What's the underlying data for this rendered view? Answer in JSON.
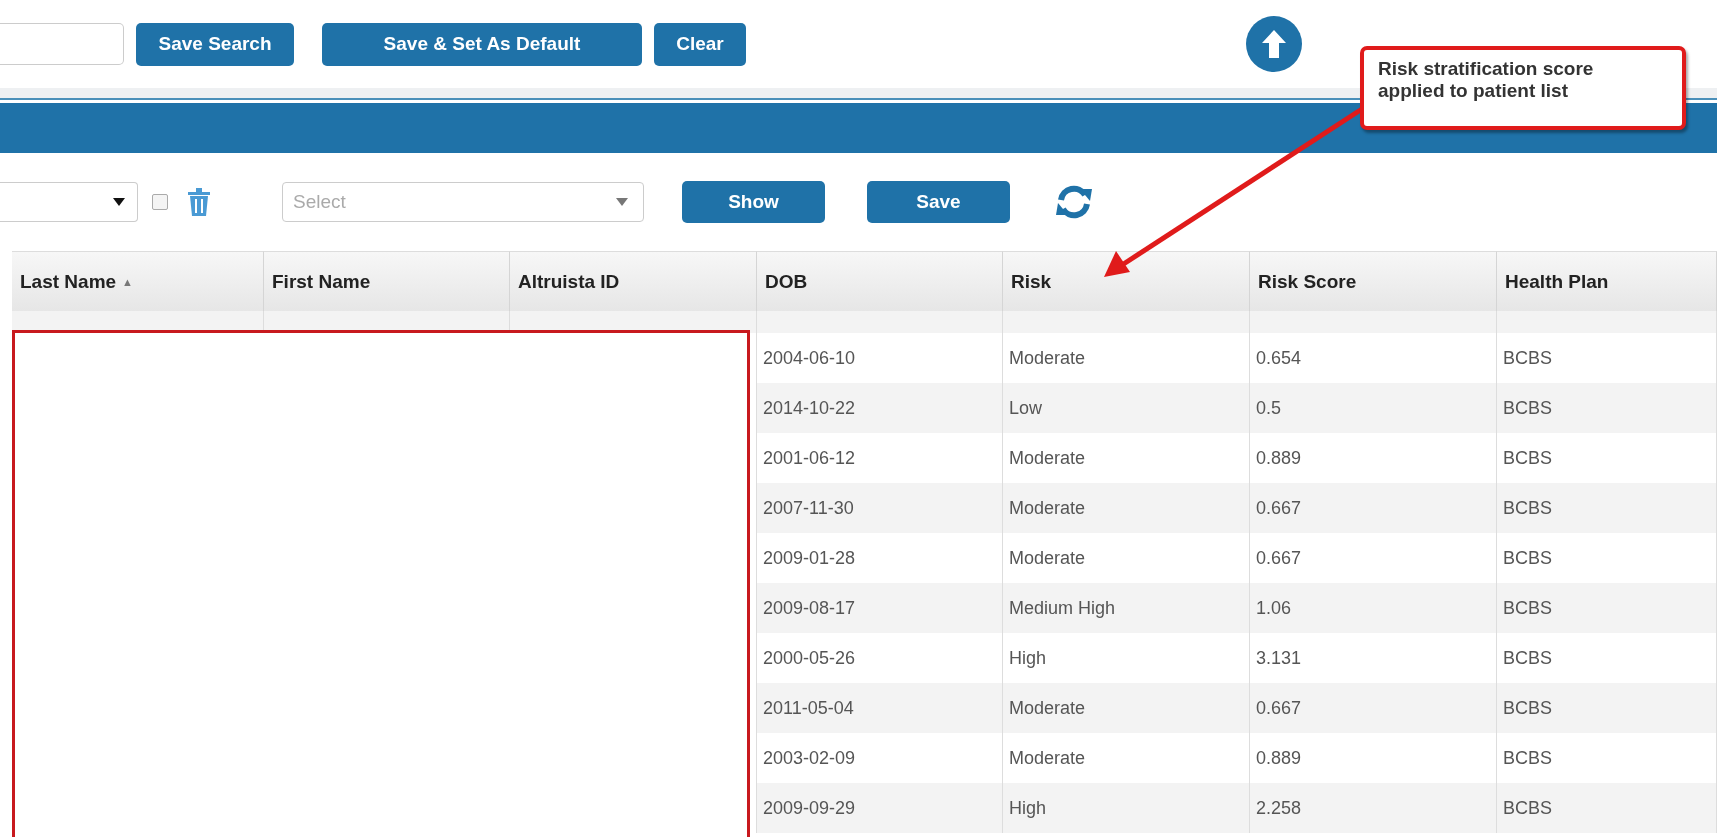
{
  "toolbar": {
    "buttons": [
      "Save Search",
      "Save & Set As Default",
      "Clear"
    ]
  },
  "filters": {
    "select": {
      "placeholder": "Select"
    },
    "checkbox": {
      "checked": false
    },
    "buttons": [
      "Show",
      "Save"
    ]
  },
  "table": {
    "columns": [
      {
        "label": "Last Name",
        "sort": "▲"
      },
      {
        "label": "First Name"
      },
      {
        "label": "Altruista ID"
      },
      {
        "label": "DOB"
      },
      {
        "label": "Risk"
      },
      {
        "label": "Risk Score"
      },
      {
        "label": "Health Plan"
      }
    ],
    "rows": [
      {
        "dob": "2004-06-10",
        "risk": "Moderate",
        "risk_score": "0.654",
        "health_plan": "BCBS"
      },
      {
        "dob": "2014-10-22",
        "risk": "Low",
        "risk_score": "0.5",
        "health_plan": "BCBS"
      },
      {
        "dob": "2001-06-12",
        "risk": "Moderate",
        "risk_score": "0.889",
        "health_plan": "BCBS"
      },
      {
        "dob": "2007-11-30",
        "risk": "Moderate",
        "risk_score": "0.667",
        "health_plan": "BCBS"
      },
      {
        "dob": "2009-01-28",
        "risk": "Moderate",
        "risk_score": "0.667",
        "health_plan": "BCBS"
      },
      {
        "dob": "2009-08-17",
        "risk": "Medium High",
        "risk_score": "1.06",
        "health_plan": "BCBS"
      },
      {
        "dob": "2000-05-26",
        "risk": "High",
        "risk_score": "3.131",
        "health_plan": "BCBS"
      },
      {
        "dob": "2011-05-04",
        "risk": "Moderate",
        "risk_score": "0.667",
        "health_plan": "BCBS"
      },
      {
        "dob": "2003-02-09",
        "risk": "Moderate",
        "risk_score": "0.889",
        "health_plan": "BCBS"
      },
      {
        "dob": "2009-09-29",
        "risk": "High",
        "risk_score": "2.258",
        "health_plan": "BCBS"
      }
    ]
  },
  "callout": {
    "text": "Risk stratification score applied to patient list"
  }
}
